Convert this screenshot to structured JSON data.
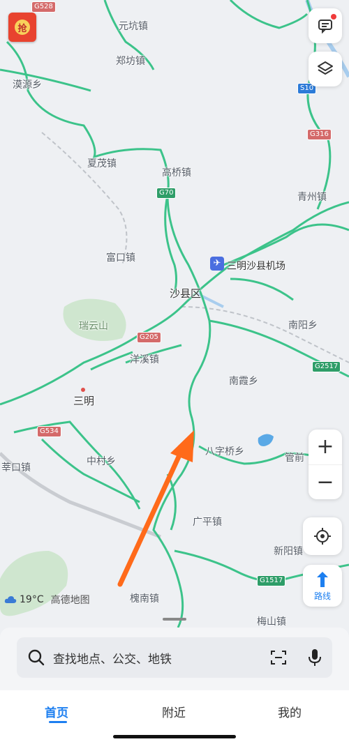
{
  "map": {
    "labels": [
      {
        "id": "yuankeng",
        "text": "元坑镇"
      },
      {
        "id": "zhengfang",
        "text": "郑坊镇"
      },
      {
        "id": "moyuan",
        "text": "漠源乡"
      },
      {
        "id": "xiamao",
        "text": "夏茂镇"
      },
      {
        "id": "gaoqiao",
        "text": "高桥镇"
      },
      {
        "id": "qingzhou",
        "text": "青州镇"
      },
      {
        "id": "fukou",
        "text": "富口镇"
      },
      {
        "id": "shaxian",
        "text": "沙县区"
      },
      {
        "id": "nanyang",
        "text": "南阳乡"
      },
      {
        "id": "ruiyunshan",
        "text": "瑞云山"
      },
      {
        "id": "yangxi",
        "text": "洋溪镇"
      },
      {
        "id": "nanxia",
        "text": "南霞乡"
      },
      {
        "id": "sanming",
        "text": "三明"
      },
      {
        "id": "zhongcun",
        "text": "中村乡"
      },
      {
        "id": "baziqiao",
        "text": "八字桥乡"
      },
      {
        "id": "guanqian",
        "text": "管前"
      },
      {
        "id": "shenkou",
        "text": "莘口镇"
      },
      {
        "id": "guangping",
        "text": "广平镇"
      },
      {
        "id": "xinyang",
        "text": "新阳镇"
      },
      {
        "id": "huainan",
        "text": "槐南镇"
      },
      {
        "id": "meishan",
        "text": "梅山镇"
      },
      {
        "id": "airport",
        "text": "三明沙县机场"
      }
    ],
    "shields": [
      {
        "id": "g528",
        "text": "G528",
        "kind": "red"
      },
      {
        "id": "s10",
        "text": "S10",
        "kind": "blue"
      },
      {
        "id": "g316",
        "text": "G316",
        "kind": "red"
      },
      {
        "id": "g70",
        "text": "G70",
        "kind": "green"
      },
      {
        "id": "g205",
        "text": "G205",
        "kind": "red"
      },
      {
        "id": "g2517",
        "text": "G2517",
        "kind": "green"
      },
      {
        "id": "g534",
        "text": "G534",
        "kind": "red"
      },
      {
        "id": "g1517",
        "text": "G1517",
        "kind": "green"
      }
    ]
  },
  "promo_badge": "抢",
  "weather": {
    "temp": "19°C",
    "brand": "高德地图"
  },
  "controls": {
    "zoom_in": "+",
    "zoom_out": "−",
    "route_label": "路线"
  },
  "search": {
    "placeholder": "查找地点、公交、地铁"
  },
  "tabs": [
    {
      "label": "首页",
      "active": true
    },
    {
      "label": "附近",
      "active": false
    },
    {
      "label": "我的",
      "active": false
    }
  ],
  "colors": {
    "accent": "#1d7ff0",
    "road": "#3cc38a",
    "arrow": "#ff6a1a",
    "water": "#5aa9e6",
    "park": "#cfe6cf"
  },
  "icons": [
    "message-icon",
    "layers-icon",
    "locate-icon",
    "route-icon",
    "search-icon",
    "scan-icon",
    "mic-icon",
    "cloud-icon"
  ]
}
